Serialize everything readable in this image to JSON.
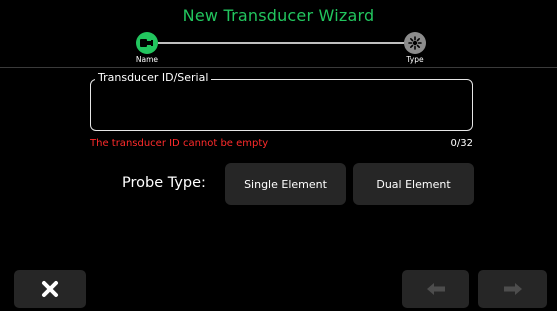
{
  "header": {
    "title": "New Transducer Wizard"
  },
  "stepper": {
    "steps": [
      {
        "label": "Name",
        "icon": "transducer-icon",
        "active": true
      },
      {
        "label": "Type",
        "icon": "probe-type-icon",
        "active": false
      }
    ]
  },
  "field": {
    "legend": "Transducer ID/Serial",
    "value": "",
    "error": "The transducer ID cannot be empty",
    "count": "0/32"
  },
  "probe": {
    "label": "Probe Type:",
    "options": [
      "Single Element",
      "Dual Element"
    ]
  },
  "footer": {
    "close_icon": "close-icon",
    "back_icon": "arrow-left-icon",
    "next_icon": "arrow-right-icon"
  },
  "colors": {
    "accent": "#22c55e",
    "error": "#ff2b2b",
    "button_bg": "#262626",
    "inactive_step": "#8c8c8c"
  }
}
